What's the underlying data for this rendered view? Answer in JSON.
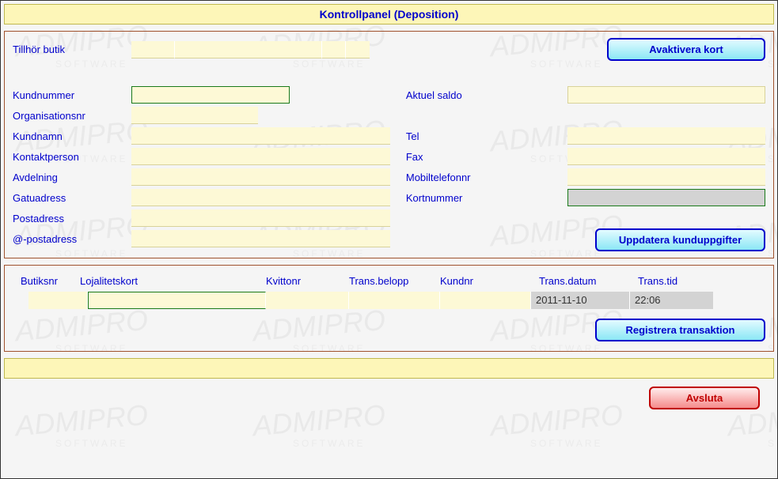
{
  "header": {
    "title": "Kontrollpanel (Deposition)"
  },
  "top": {
    "tillhor_butik_label": "Tillhör butik",
    "avaktivera_kort_label": "Avaktivera kort"
  },
  "customer": {
    "kundnummer_label": "Kundnummer",
    "organisationsnr_label": "Organisationsnr",
    "kundnamn_label": "Kundnamn",
    "kontaktperson_label": "Kontaktperson",
    "avdelning_label": "Avdelning",
    "gatuadress_label": "Gatuadress",
    "postadress_label": "Postadress",
    "epostadress_label": "@-postadress",
    "aktuel_saldo_label": "Aktuel saldo",
    "tel_label": "Tel",
    "fax_label": "Fax",
    "mobiltelefonnr_label": "Mobiltelefonnr",
    "kortnummer_label": "Kortnummer",
    "uppdatera_btn_label": "Uppdatera kunduppgifter",
    "values": {
      "kundnummer": "",
      "organisationsnr": "",
      "kundnamn": "",
      "kontaktperson": "",
      "avdelning": "",
      "gatuadress": "",
      "postadress": "",
      "epostadress": "",
      "aktuel_saldo": "",
      "tel": "",
      "fax": "",
      "mobiltelefonnr": "",
      "kortnummer": ""
    }
  },
  "trans": {
    "headers": {
      "butiksnr": "Butiksnr",
      "lojalitetskort": "Lojalitetskort",
      "kvittonr": "Kvittonr",
      "trans_belopp": "Trans.belopp",
      "kundnr": "Kundnr",
      "trans_datum": "Trans.datum",
      "trans_tid": "Trans.tid"
    },
    "row": {
      "butiksnr": "",
      "lojalitetskort": "",
      "kvittonr": "",
      "trans_belopp": "",
      "kundnr": "",
      "trans_datum": "2011-11-10",
      "trans_tid": "22:06"
    },
    "registrera_btn_label": "Registrera transaktion"
  },
  "footer": {
    "avsluta_label": "Avsluta"
  }
}
